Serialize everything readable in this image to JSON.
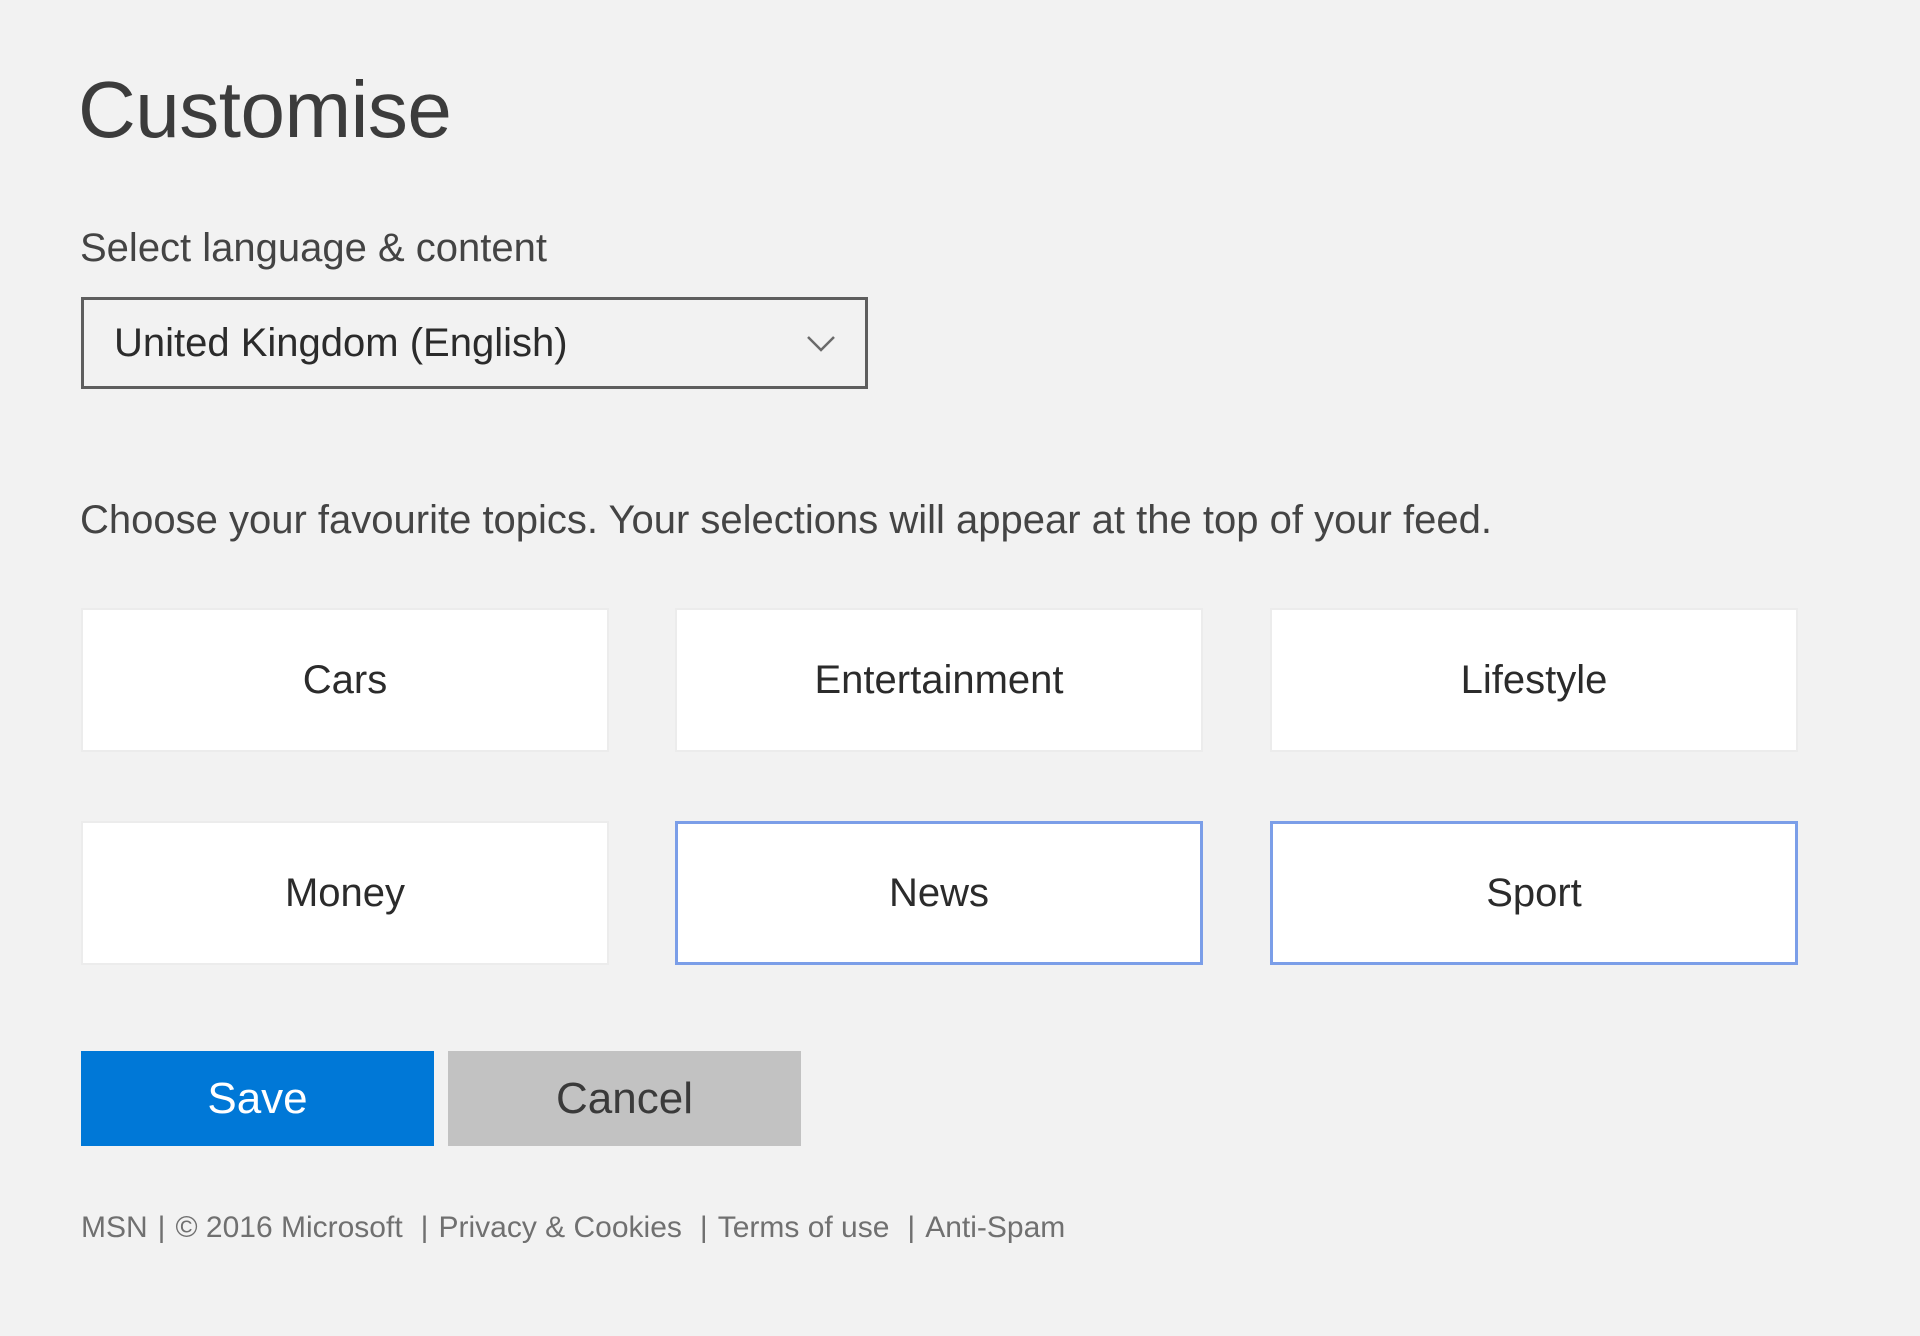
{
  "page": {
    "title": "Customise"
  },
  "language": {
    "label": "Select language & content",
    "selected": "United Kingdom (English)",
    "icon": "chevron-down-icon"
  },
  "topics": {
    "description": "Choose your favourite topics. Your selections will appear at the top of your feed.",
    "items": [
      {
        "label": "Cars",
        "selected": false
      },
      {
        "label": "Entertainment",
        "selected": false
      },
      {
        "label": "Lifestyle",
        "selected": false
      },
      {
        "label": "Money",
        "selected": false
      },
      {
        "label": "News",
        "selected": true
      },
      {
        "label": "Sport",
        "selected": true
      }
    ]
  },
  "actions": {
    "save_label": "Save",
    "cancel_label": "Cancel"
  },
  "footer": {
    "brand": "MSN",
    "copyright": "© 2016 Microsoft",
    "separator": "|",
    "links": [
      "Privacy & Cookies",
      "Terms of use",
      "Anti-Spam"
    ]
  },
  "colors": {
    "accent": "#0078d7",
    "selected_border": "#7b9ee8",
    "cancel_bg": "#c2c2c2",
    "page_bg": "#f2f2f2"
  }
}
